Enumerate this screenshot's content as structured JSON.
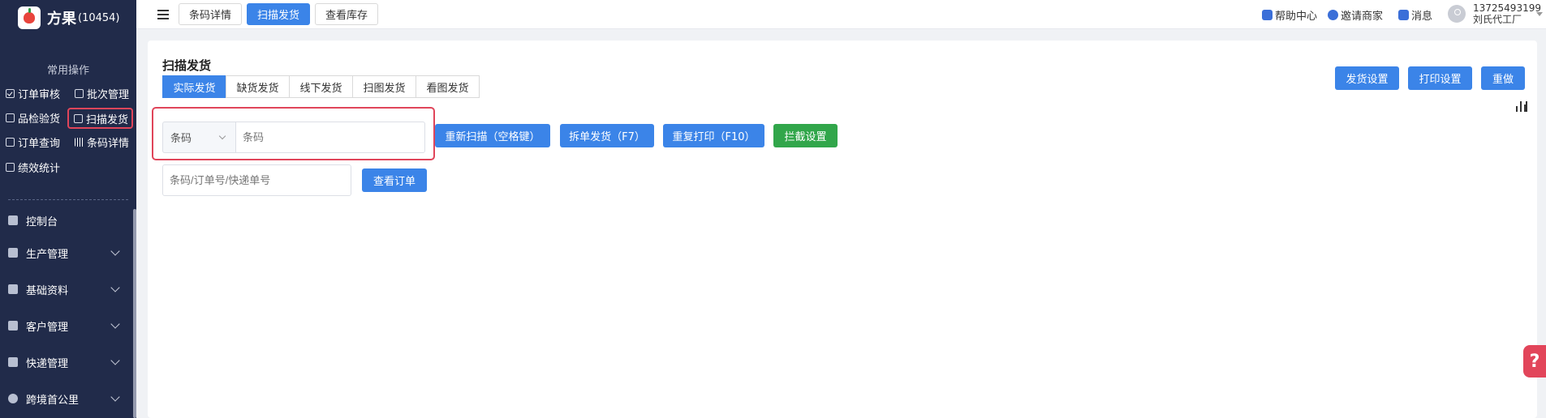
{
  "app": {
    "name": "方果",
    "id": "(10454)"
  },
  "sidebar": {
    "section_title": "常用操作",
    "quick_ops": [
      {
        "label": "订单审核",
        "icon": "check-square-icon"
      },
      {
        "label": "批次管理",
        "icon": "batch-icon"
      },
      {
        "label": "品检验货",
        "icon": "inspect-icon"
      },
      {
        "label": "扫描发货",
        "icon": "scan-icon",
        "active": true
      },
      {
        "label": "订单查询",
        "icon": "search-doc-icon"
      },
      {
        "label": "条码详情",
        "icon": "barcode-icon"
      },
      {
        "label": "绩效统计",
        "icon": "stats-icon"
      }
    ],
    "nav": [
      {
        "label": "控制台",
        "icon": "dashboard-icon"
      },
      {
        "label": "生产管理",
        "icon": "production-icon"
      },
      {
        "label": "基础资料",
        "icon": "database-icon"
      },
      {
        "label": "客户管理",
        "icon": "customer-icon"
      },
      {
        "label": "快递管理",
        "icon": "express-icon"
      },
      {
        "label": "跨境首公里",
        "icon": "globe-icon"
      }
    ]
  },
  "topbar": {
    "tabs": [
      {
        "label": "条码详情",
        "active": false
      },
      {
        "label": "扫描发货",
        "active": true
      },
      {
        "label": "查看库存",
        "active": false
      }
    ],
    "help_label": "帮助中心",
    "invite_label": "邀请商家",
    "message_label": "消息",
    "user_phone": "13725493199",
    "user_company": "刘氏代工厂"
  },
  "main": {
    "title": "扫描发货",
    "subtabs": [
      {
        "label": "实际发货",
        "active": true
      },
      {
        "label": "缺货发货",
        "active": false
      },
      {
        "label": "线下发货",
        "active": false
      },
      {
        "label": "扫图发货",
        "active": false
      },
      {
        "label": "看图发货",
        "active": false
      }
    ],
    "settings_buttons": [
      "发货设置",
      "打印设置",
      "重做"
    ],
    "scan_type_selected": "条码",
    "scan_input_placeholder": "条码",
    "action_buttons": [
      "重新扫描（空格键）",
      "拆单发货（F7）",
      "重复打印（F10）",
      "拦截设置"
    ],
    "query_placeholder": "条码/订单号/快递单号",
    "query_button": "查看订单"
  },
  "colors": {
    "sidebar_bg": "#212b4a",
    "primary": "#3b84e8",
    "green": "#31a64a",
    "highlight": "#e0455a"
  }
}
